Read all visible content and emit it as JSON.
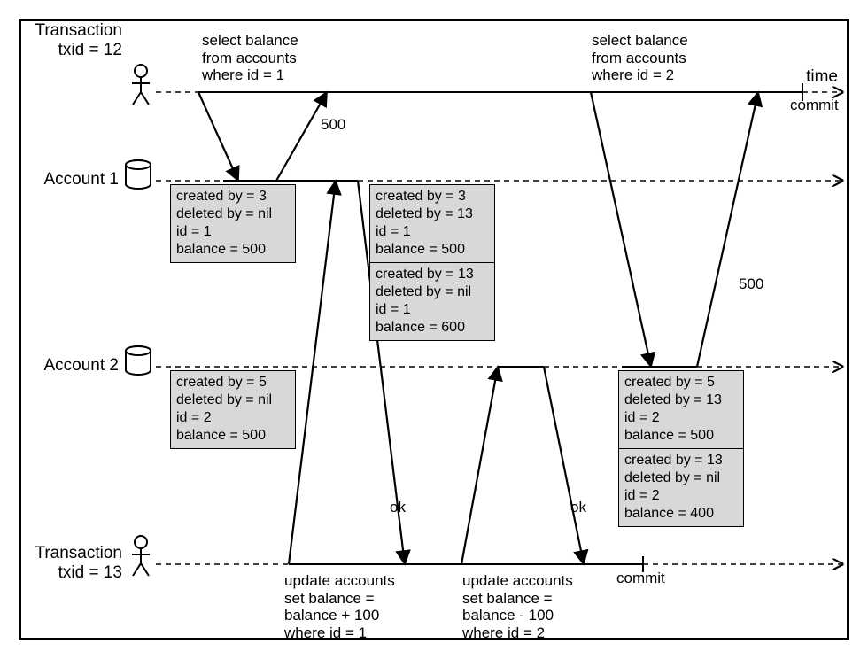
{
  "time_label": "time",
  "commit_label_top": "commit",
  "commit_label_bottom": "commit",
  "lanes": {
    "t12": "Transaction\ntxid = 12",
    "a1": "Account 1",
    "a2": "Account 2",
    "t13": "Transaction\ntxid = 13"
  },
  "queries": {
    "q12_1": "select balance\nfrom accounts\nwhere id = 1",
    "q12_2": "select balance\nfrom accounts\nwhere id = 2",
    "q13_1": "update accounts\nset balance =\nbalance + 100\nwhere id = 1",
    "q13_2": "update accounts\nset balance =\nbalance - 100\nwhere id = 2"
  },
  "edge_labels": {
    "resp500_a": "500",
    "resp500_b": "500",
    "ok1": "ok",
    "ok2": "ok"
  },
  "versions": {
    "a1_initial": "created by = 3\ndeleted by = nil\nid = 1\nbalance = 500",
    "a1_old": "created by = 3\ndeleted by = 13\nid = 1\nbalance = 500",
    "a1_new": "created by = 13\ndeleted by = nil\nid = 1\nbalance = 600",
    "a2_initial": "created by = 5\ndeleted by = nil\nid = 2\nbalance = 500",
    "a2_old": "created by = 5\ndeleted by = 13\nid = 2\nbalance = 500",
    "a2_new": "created by = 13\ndeleted by = nil\nid = 2\nbalance = 400"
  }
}
